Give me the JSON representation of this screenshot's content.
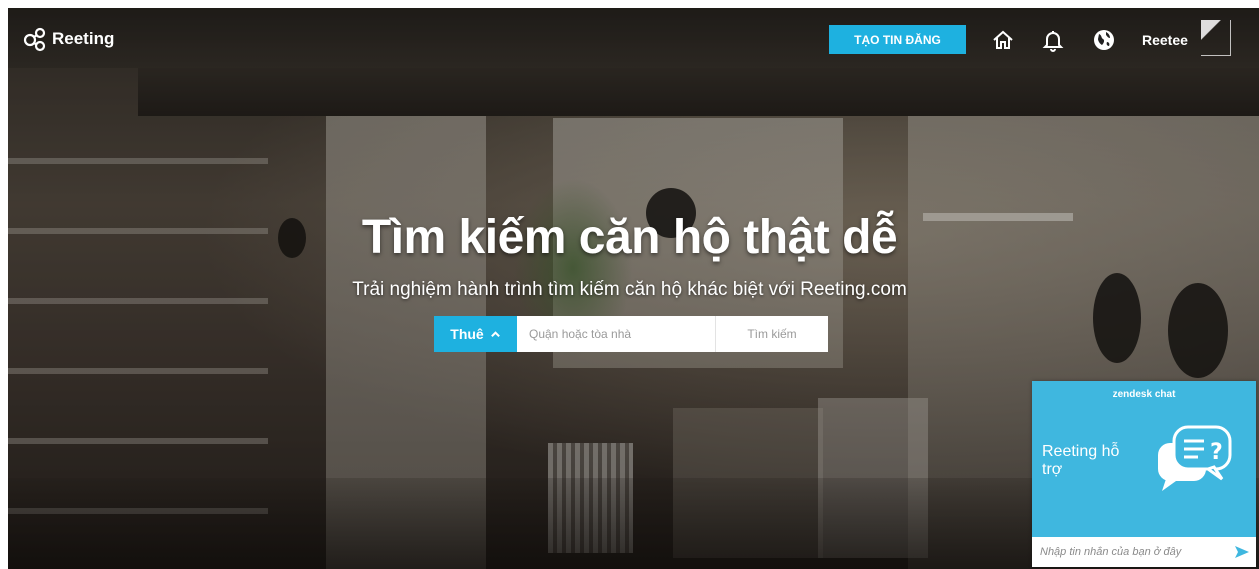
{
  "header": {
    "logo_text": "Reeting",
    "create_button": "TẠO TIN ĐĂNG",
    "user_name": "Reetee",
    "icons": [
      "home-icon",
      "bell-icon",
      "globe-icon"
    ]
  },
  "hero": {
    "title": "Tìm kiếm căn hộ thật dễ",
    "subtitle": "Trải nghiệm hành trình tìm kiếm căn hộ khác biệt với Reeting.com"
  },
  "search": {
    "type_label": "Thuê",
    "placeholder": "Quận hoặc tòa nhà",
    "button_label": "Tìm kiếm"
  },
  "chat": {
    "provider": "zendesk chat",
    "title": "Reeting hỗ trợ",
    "placeholder": "Nhập tin nhắn của bạn ở đây"
  },
  "colors": {
    "accent": "#1eb1e0",
    "chat_bg": "#3fb7df"
  }
}
